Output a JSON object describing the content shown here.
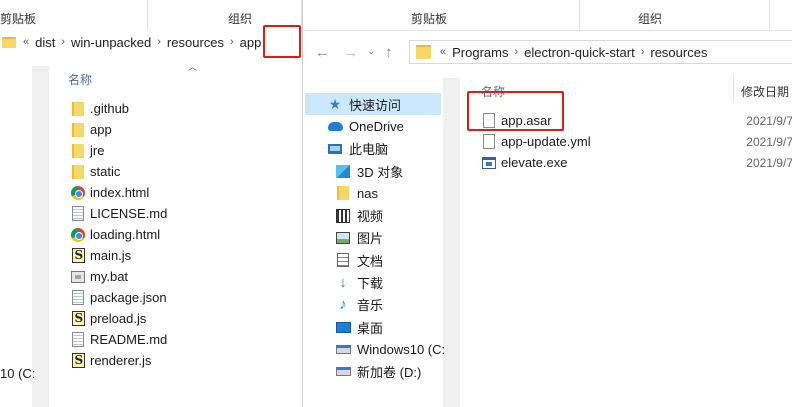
{
  "left_window": {
    "ribbon": {
      "clipboard_label": "剪贴板",
      "organize_label": "组织"
    },
    "breadcrumb": [
      "dist",
      "win-unpacked",
      "resources",
      "app"
    ],
    "breadcrumb_overflow": "«",
    "column_name": "名称",
    "files": [
      {
        "name": ".github",
        "icon": "folder-icon"
      },
      {
        "name": "app",
        "icon": "folder-icon"
      },
      {
        "name": "jre",
        "icon": "folder-icon"
      },
      {
        "name": "static",
        "icon": "folder-icon"
      },
      {
        "name": "index.html",
        "icon": "chrome-icon"
      },
      {
        "name": "LICENSE.md",
        "icon": "document-icon"
      },
      {
        "name": "loading.html",
        "icon": "chrome-icon"
      },
      {
        "name": "main.js",
        "icon": "script-icon"
      },
      {
        "name": "my.bat",
        "icon": "batch-icon"
      },
      {
        "name": "package.json",
        "icon": "document-icon"
      },
      {
        "name": "preload.js",
        "icon": "script-icon"
      },
      {
        "name": "README.md",
        "icon": "document-icon"
      },
      {
        "name": "renderer.js",
        "icon": "script-icon"
      }
    ],
    "drive_label_partial": "10 (C:"
  },
  "right_window": {
    "ribbon": {
      "clipboard_label": "剪贴板",
      "organize_label": "组织"
    },
    "breadcrumb": [
      "Programs",
      "electron-quick-start",
      "resources"
    ],
    "breadcrumb_overflow": "«",
    "column_name": "名称",
    "column_modified": "修改日期",
    "nav": [
      {
        "label": "快速访问",
        "icon": "star-icon",
        "selected": true
      },
      {
        "label": "OneDrive",
        "icon": "cloud-icon"
      },
      {
        "label": "此电脑",
        "icon": "computer-icon"
      },
      {
        "label": "3D 对象",
        "icon": "cube-icon"
      },
      {
        "label": "nas",
        "icon": "folder-icon"
      },
      {
        "label": "视频",
        "icon": "video-icon"
      },
      {
        "label": "图片",
        "icon": "picture-icon"
      },
      {
        "label": "文档",
        "icon": "documents-icon"
      },
      {
        "label": "下载",
        "icon": "download-icon"
      },
      {
        "label": "音乐",
        "icon": "music-icon"
      },
      {
        "label": "桌面",
        "icon": "desktop-icon"
      },
      {
        "label": "Windows10 (C:",
        "icon": "drive-icon"
      },
      {
        "label": "新加卷 (D:)",
        "icon": "drive-icon"
      }
    ],
    "files": [
      {
        "name": "app.asar",
        "date": "2021/9/7",
        "icon": "document-icon"
      },
      {
        "name": "app-update.yml",
        "date": "2021/9/7",
        "icon": "document-icon"
      },
      {
        "name": "elevate.exe",
        "date": "2021/9/7",
        "icon": "exe-icon"
      }
    ]
  },
  "colors": {
    "highlight": "#e8190f",
    "selected_nav": "#cce8ff",
    "header_text": "#4d6aa8"
  }
}
